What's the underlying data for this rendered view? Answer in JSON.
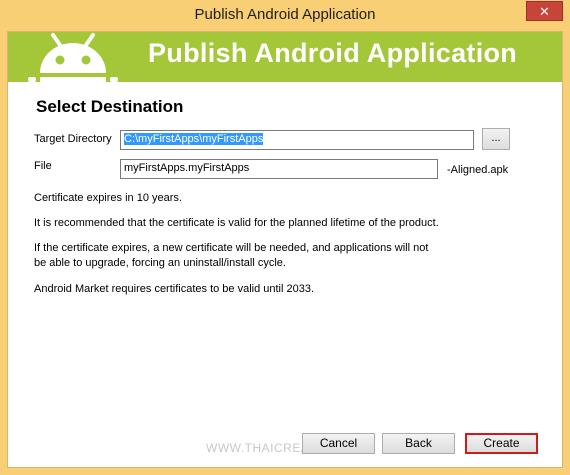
{
  "window": {
    "title": "Publish Android Application",
    "close_glyph": "✕"
  },
  "banner": {
    "title": "Publish Android Application",
    "logo_icon": "android-logo-icon",
    "color": "#a4c639"
  },
  "section": {
    "title": "Select Destination"
  },
  "form": {
    "target_directory_label": "Target Directory",
    "target_directory_value": "C:\\myFirstApps\\myFirstApps",
    "browse_label": "...",
    "file_label": "File",
    "file_value": "myFirstApps.myFirstApps",
    "file_suffix": "-Aligned.apk"
  },
  "info": {
    "cert_expiry": "Certificate expires in 10 years.",
    "recommendation": "It is recommended that the certificate is valid for the planned lifetime of the product.",
    "expiry_warning_line1": "If the certificate expires, a new certificate will be needed, and applications will not",
    "expiry_warning_line2": "be able to upgrade, forcing an uninstall/install cycle.",
    "market_requirement": "Android Market requires certificates to be valid until 2033."
  },
  "watermark": "WWW.THAICREATE.COM",
  "buttons": {
    "cancel": "Cancel",
    "back": "Back",
    "create": "Create"
  },
  "colors": {
    "titlebar": "#f9cf76",
    "close_button": "#c7443b",
    "selection": "#3399ff",
    "highlight_border": "#d11a1a"
  }
}
